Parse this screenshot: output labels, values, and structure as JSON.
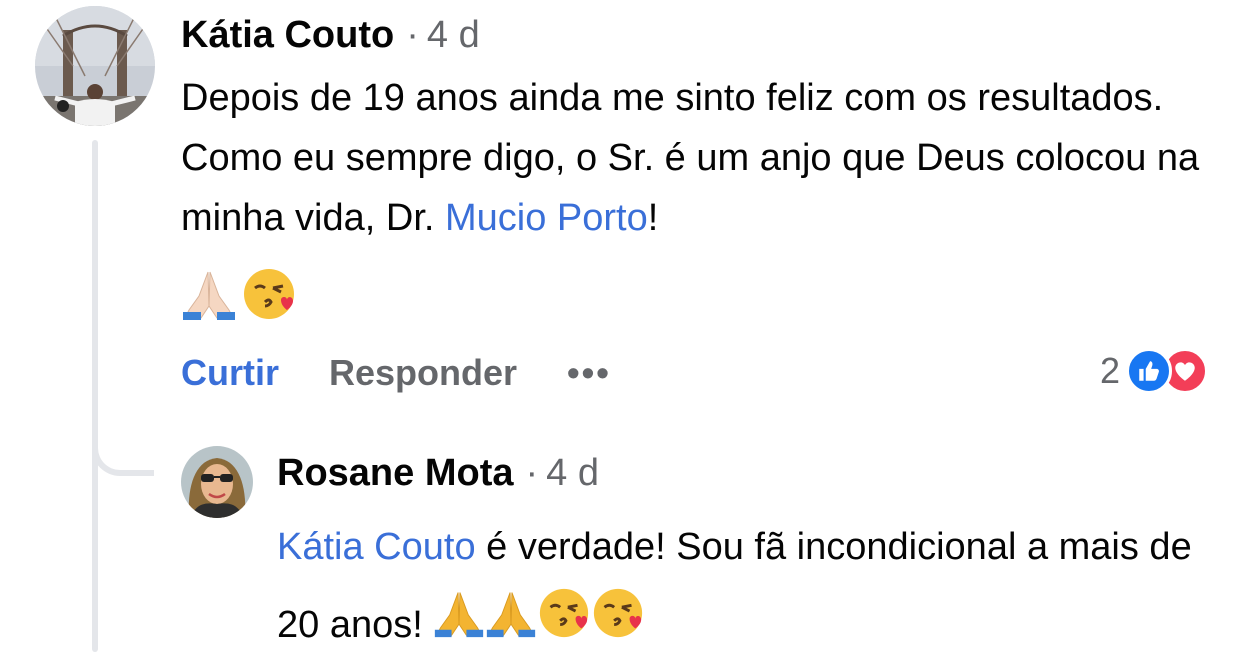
{
  "comment": {
    "author": "Kátia Couto",
    "separator": "·",
    "time": "4 d",
    "text_before_mention": "Depois de 19 anos ainda me sinto feliz com os resultados. Como eu sempre digo, o Sr. é um anjo que Deus colocou na minha vida, Dr. ",
    "mention": "Mucio Porto",
    "text_after_mention": "!",
    "emojis": [
      "folded-hands",
      "kiss-face"
    ],
    "actions": {
      "like": "Curtir",
      "reply": "Responder",
      "more": "•••"
    },
    "reaction_count": "2",
    "reaction_icons": [
      "like-icon",
      "love-icon"
    ]
  },
  "reply": {
    "author": "Rosane Mota",
    "separator": "·",
    "time": "4 d",
    "mention": "Kátia Couto",
    "text_after_mention": " é verdade! Sou fã incondicional a mais de 20 anos! ",
    "emojis": [
      "folded-hands",
      "folded-hands",
      "kiss-face",
      "kiss-face"
    ]
  },
  "colors": {
    "link": "#3a6fd8",
    "secondary_text": "#65676b",
    "primary_text": "#050505",
    "like_blue": "#1877f2",
    "love_red": "#f33e58",
    "thread_line": "#e4e6ea"
  }
}
